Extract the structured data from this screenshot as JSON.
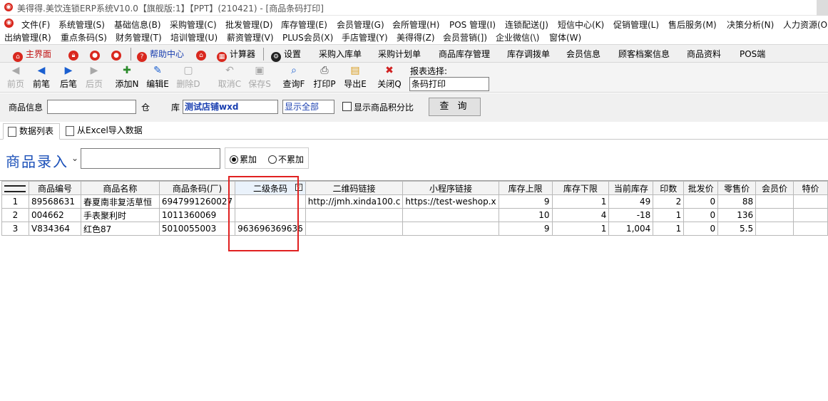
{
  "window": {
    "title": "美得得.美饮连锁ERP系统V10.0【旗舰版:1】【PPT】(210421) - [商品条码打印]"
  },
  "menu": {
    "row1": [
      "文件(F)",
      "系统管理(S)",
      "基础信息(B)",
      "采购管理(C)",
      "批发管理(D)",
      "库存管理(E)",
      "会员管理(G)",
      "会所管理(H)",
      "POS 管理(I)",
      "连锁配送(J)",
      "短信中心(K)",
      "促销管理(L)",
      "售后服务(M)",
      "决策分析(N)",
      "人力资源(O"
    ],
    "row2": [
      "出纳管理(R)",
      "重点条码(S)",
      "财务管理(T)",
      "培训管理(U)",
      "薪资管理(V)",
      "PLUS会员(X)",
      "手店管理(Y)",
      "美得得(Z)",
      "会员营销(])",
      "企业微信(\\)",
      "窗体(W)"
    ]
  },
  "quickbar": {
    "home": "主界面",
    "help": "帮助中心",
    "calculator": "计算器",
    "settings": "设置",
    "links": [
      "采购入库单",
      "采购计划单",
      "商品库存管理",
      "库存调拨单",
      "会员信息",
      "顾客档案信息",
      "商品资料",
      "POS端"
    ]
  },
  "toolbar": {
    "first": "前页",
    "prev": "前笔",
    "next": "后笔",
    "last": "后页",
    "add": "添加N",
    "edit": "编辑E",
    "delete": "删除D",
    "cancel": "取消C",
    "save": "保存S",
    "query": "查询F",
    "print": "打印P",
    "export": "导出E",
    "close": "关闭Q",
    "report_label": "报表选择:",
    "report_value": "条码打印"
  },
  "filter": {
    "product_label": "商品信息",
    "product_value": "",
    "warehouse_label": "仓",
    "store_label": "库",
    "store_value": "测试店铺wxd",
    "show_value": "显示全部",
    "points_label": "显示商品积分比",
    "query_button": "查 询"
  },
  "tabs": {
    "data_list": "数据列表",
    "import_excel": "从Excel导入数据"
  },
  "entry": {
    "label": "商品录入",
    "accumulate": "累加",
    "no_accumulate": "不累加"
  },
  "table": {
    "headers": [
      "商品编号",
      "商品名称",
      "商品条码(厂)",
      "二级条码",
      "二维码链接",
      "小程序链接",
      "库存上限",
      "库存下限",
      "当前库存",
      "印数",
      "批发价",
      "零售价",
      "会员价",
      "特价"
    ],
    "rows": [
      {
        "n": "1",
        "code": "89568631",
        "name": "春夏南非复活草恒",
        "barcode": "6947991260027",
        "barcode2": "",
        "qr": "http://jmh.xinda100.c",
        "mini": "https://test-weshop.x",
        "max": "9",
        "min": "1",
        "stock": "49",
        "print": "2",
        "wholesale": "0",
        "retail": "88",
        "member": "",
        "special": ""
      },
      {
        "n": "2",
        "code": "004662",
        "name": "手表聚利时",
        "barcode": "1011360069",
        "barcode2": "",
        "qr": "",
        "mini": "",
        "max": "10",
        "min": "4",
        "stock": "-18",
        "print": "1",
        "wholesale": "0",
        "retail": "136",
        "member": "",
        "special": ""
      },
      {
        "n": "3",
        "code": "V834364",
        "name": "红色87",
        "barcode": "5010055003",
        "barcode2": "963696369636",
        "qr": "",
        "mini": "",
        "max": "9",
        "min": "1",
        "stock": "1,004",
        "print": "1",
        "wholesale": "0",
        "retail": "5.5",
        "member": "",
        "special": ""
      }
    ]
  }
}
